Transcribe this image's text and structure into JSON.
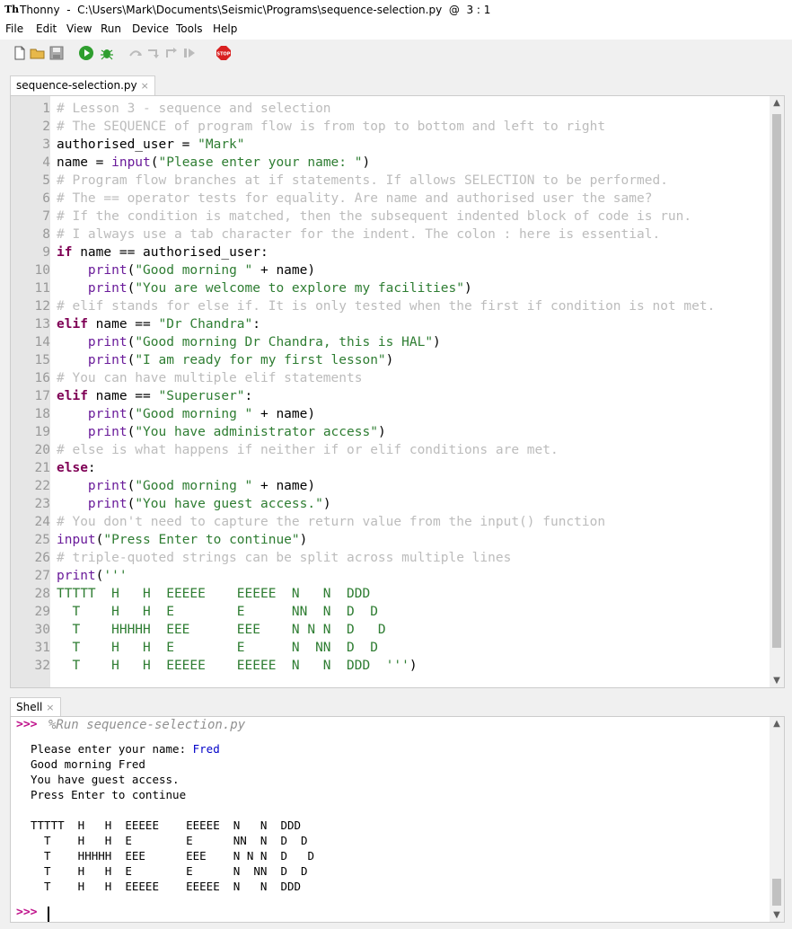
{
  "window": {
    "title": "Thonny  -  C:\\Users\\Mark\\Documents\\Seismic\\Programs\\sequence-selection.py  @  3 : 1",
    "app_icon": "Th"
  },
  "menu": [
    "File",
    "Edit",
    "View",
    "Run",
    "Device",
    "Tools",
    "Help"
  ],
  "toolbar": {
    "icons": [
      "new-file-icon",
      "open-folder-icon",
      "save-icon",
      "run-icon",
      "debug-icon",
      "step-over-icon",
      "step-into-icon",
      "step-out-icon",
      "resume-icon",
      "stop-icon"
    ],
    "stop_label": "STOP",
    "colors": {
      "run": "#2e9e2e",
      "stop": "#d92020"
    }
  },
  "editor": {
    "tab_label": "sequence-selection.py",
    "lines": [
      [
        [
          "c",
          "# Lesson 3 - sequence and selection"
        ]
      ],
      [
        [
          "c",
          "# The SEQUENCE of program flow is from top to bottom and left to right"
        ]
      ],
      [
        [
          "p",
          "authorised_user = "
        ],
        [
          "s",
          "\"Mark\""
        ]
      ],
      [
        [
          "p",
          "name = "
        ],
        [
          "b",
          "input"
        ],
        [
          "p",
          "("
        ],
        [
          "s",
          "\"Please enter your name: \""
        ],
        [
          "p",
          ")"
        ]
      ],
      [
        [
          "c",
          "# Program flow branches at if statements. If allows SELECTION to be performed."
        ]
      ],
      [
        [
          "c",
          "# The == operator tests for equality. Are name and authorised user the same?"
        ]
      ],
      [
        [
          "c",
          "# If the condition is matched, then the subsequent indented block of code is run."
        ]
      ],
      [
        [
          "c",
          "# I always use a tab character for the indent. The colon : here is essential."
        ]
      ],
      [
        [
          "k",
          "if"
        ],
        [
          "p",
          " name == authorised_user:"
        ]
      ],
      [
        [
          "p",
          "    "
        ],
        [
          "b",
          "print"
        ],
        [
          "p",
          "("
        ],
        [
          "s",
          "\"Good morning \""
        ],
        [
          "p",
          " + name)"
        ]
      ],
      [
        [
          "p",
          "    "
        ],
        [
          "b",
          "print"
        ],
        [
          "p",
          "("
        ],
        [
          "s",
          "\"You are welcome to explore my facilities\""
        ],
        [
          "p",
          ")"
        ]
      ],
      [
        [
          "c",
          "# elif stands for else if. It is only tested when the first if condition is not met."
        ]
      ],
      [
        [
          "k",
          "elif"
        ],
        [
          "p",
          " name == "
        ],
        [
          "s",
          "\"Dr Chandra\""
        ],
        [
          "p",
          ":"
        ]
      ],
      [
        [
          "p",
          "    "
        ],
        [
          "b",
          "print"
        ],
        [
          "p",
          "("
        ],
        [
          "s",
          "\"Good morning Dr Chandra, this is HAL\""
        ],
        [
          "p",
          ")"
        ]
      ],
      [
        [
          "p",
          "    "
        ],
        [
          "b",
          "print"
        ],
        [
          "p",
          "("
        ],
        [
          "s",
          "\"I am ready for my first lesson\""
        ],
        [
          "p",
          ")"
        ]
      ],
      [
        [
          "c",
          "# You can have multiple elif statements"
        ]
      ],
      [
        [
          "k",
          "elif"
        ],
        [
          "p",
          " name == "
        ],
        [
          "s",
          "\"Superuser\""
        ],
        [
          "p",
          ":"
        ]
      ],
      [
        [
          "p",
          "    "
        ],
        [
          "b",
          "print"
        ],
        [
          "p",
          "("
        ],
        [
          "s",
          "\"Good morning \""
        ],
        [
          "p",
          " + name)"
        ]
      ],
      [
        [
          "p",
          "    "
        ],
        [
          "b",
          "print"
        ],
        [
          "p",
          "("
        ],
        [
          "s",
          "\"You have administrator access\""
        ],
        [
          "p",
          ")"
        ]
      ],
      [
        [
          "c",
          "# else is what happens if neither if or elif conditions are met."
        ]
      ],
      [
        [
          "k",
          "else"
        ],
        [
          "p",
          ":"
        ]
      ],
      [
        [
          "p",
          "    "
        ],
        [
          "b",
          "print"
        ],
        [
          "p",
          "("
        ],
        [
          "s",
          "\"Good morning \""
        ],
        [
          "p",
          " + name)"
        ]
      ],
      [
        [
          "p",
          "    "
        ],
        [
          "b",
          "print"
        ],
        [
          "p",
          "("
        ],
        [
          "s",
          "\"You have guest access.\""
        ],
        [
          "p",
          ")"
        ]
      ],
      [
        [
          "c",
          "# You don't need to capture the return value from the input() function"
        ]
      ],
      [
        [
          "b",
          "input"
        ],
        [
          "p",
          "("
        ],
        [
          "s",
          "\"Press Enter to continue\""
        ],
        [
          "p",
          ")"
        ]
      ],
      [
        [
          "c",
          "# triple-quoted strings can be split across multiple lines"
        ]
      ],
      [
        [
          "b",
          "print"
        ],
        [
          "p",
          "("
        ],
        [
          "s",
          "'''"
        ]
      ],
      [
        [
          "s",
          "TTTTT  H   H  EEEEE    EEEEE  N   N  DDD"
        ]
      ],
      [
        [
          "s",
          "  T    H   H  E        E      NN  N  D  D"
        ]
      ],
      [
        [
          "s",
          "  T    HHHHH  EEE      EEE    N N N  D   D"
        ]
      ],
      [
        [
          "s",
          "  T    H   H  E        E      N  NN  D  D"
        ]
      ],
      [
        [
          "s",
          "  T    H   H  EEEEE    EEEEE  N   N  DDD  '''"
        ],
        [
          "p",
          ")"
        ]
      ]
    ],
    "scroll_position": 0.0
  },
  "shell": {
    "tab_label": "Shell",
    "prompt": ">>>",
    "run_command": "%Run sequence-selection.py",
    "output": [
      [
        [
          "o",
          "Please enter your name: "
        ],
        [
          "u",
          "Fred"
        ]
      ],
      [
        [
          "o",
          "Good morning Fred"
        ]
      ],
      [
        [
          "o",
          "You have guest access."
        ]
      ],
      [
        [
          "o",
          "Press Enter to continue"
        ]
      ],
      [
        [
          "o",
          ""
        ]
      ],
      [
        [
          "o",
          "TTTTT  H   H  EEEEE    EEEEE  N   N  DDD"
        ]
      ],
      [
        [
          "o",
          "  T    H   H  E        E      NN  N  D  D"
        ]
      ],
      [
        [
          "o",
          "  T    HHHHH  EEE      EEE    N N N  D   D"
        ]
      ],
      [
        [
          "o",
          "  T    H   H  E        E      N  NN  D  D"
        ]
      ],
      [
        [
          "o",
          "  T    H   H  EEEEE    EEEEE  N   N  DDD"
        ]
      ]
    ],
    "scroll_position": 1.0
  }
}
